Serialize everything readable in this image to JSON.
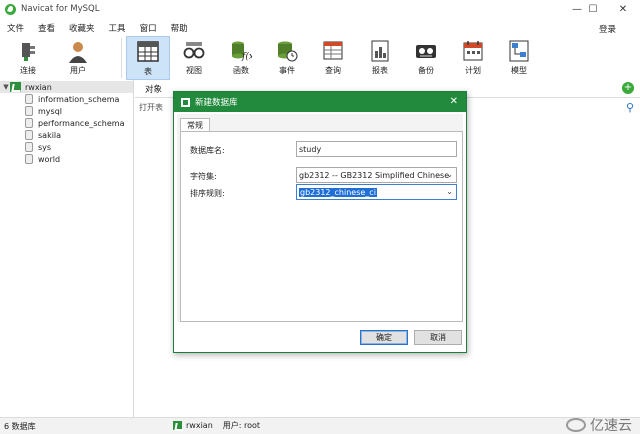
{
  "window": {
    "title": "Navicat for MySQL",
    "minimize": "—",
    "maximize": "☐",
    "close": "✕"
  },
  "menu": {
    "items": [
      "文件",
      "查看",
      "收藏夹",
      "工具",
      "窗口",
      "帮助"
    ],
    "login": "登录"
  },
  "toolbar": {
    "connect": "连接",
    "user": "用户",
    "table": "表",
    "view": "视图",
    "function": "函数",
    "event": "事件",
    "query": "查询",
    "report": "报表",
    "backup": "备份",
    "schedule": "计划",
    "model": "模型"
  },
  "tree": {
    "connection": "rwxian",
    "databases": [
      "information_schema",
      "mysql",
      "performance_schema",
      "sakila",
      "sys",
      "world"
    ]
  },
  "content": {
    "tab": "对象",
    "open_button": "打开表"
  },
  "dialog": {
    "title": "新建数据库",
    "tab": "常规",
    "name_label": "数据库名:",
    "name_value": "study",
    "charset_label": "字符集:",
    "charset_value": "gb2312 -- GB2312 Simplified Chinese",
    "collation_label": "排序规则:",
    "collation_value": "gb2312_chinese_ci",
    "ok": "确定",
    "cancel": "取消"
  },
  "status": {
    "db_count": "6 数据库",
    "connection": "rwxian",
    "user": "用户: root",
    "watermark": "亿速云"
  },
  "colors": {
    "dialog_title": "#218a3d",
    "active_tool": "#cde3f7",
    "selection": "#1f6fd6"
  }
}
